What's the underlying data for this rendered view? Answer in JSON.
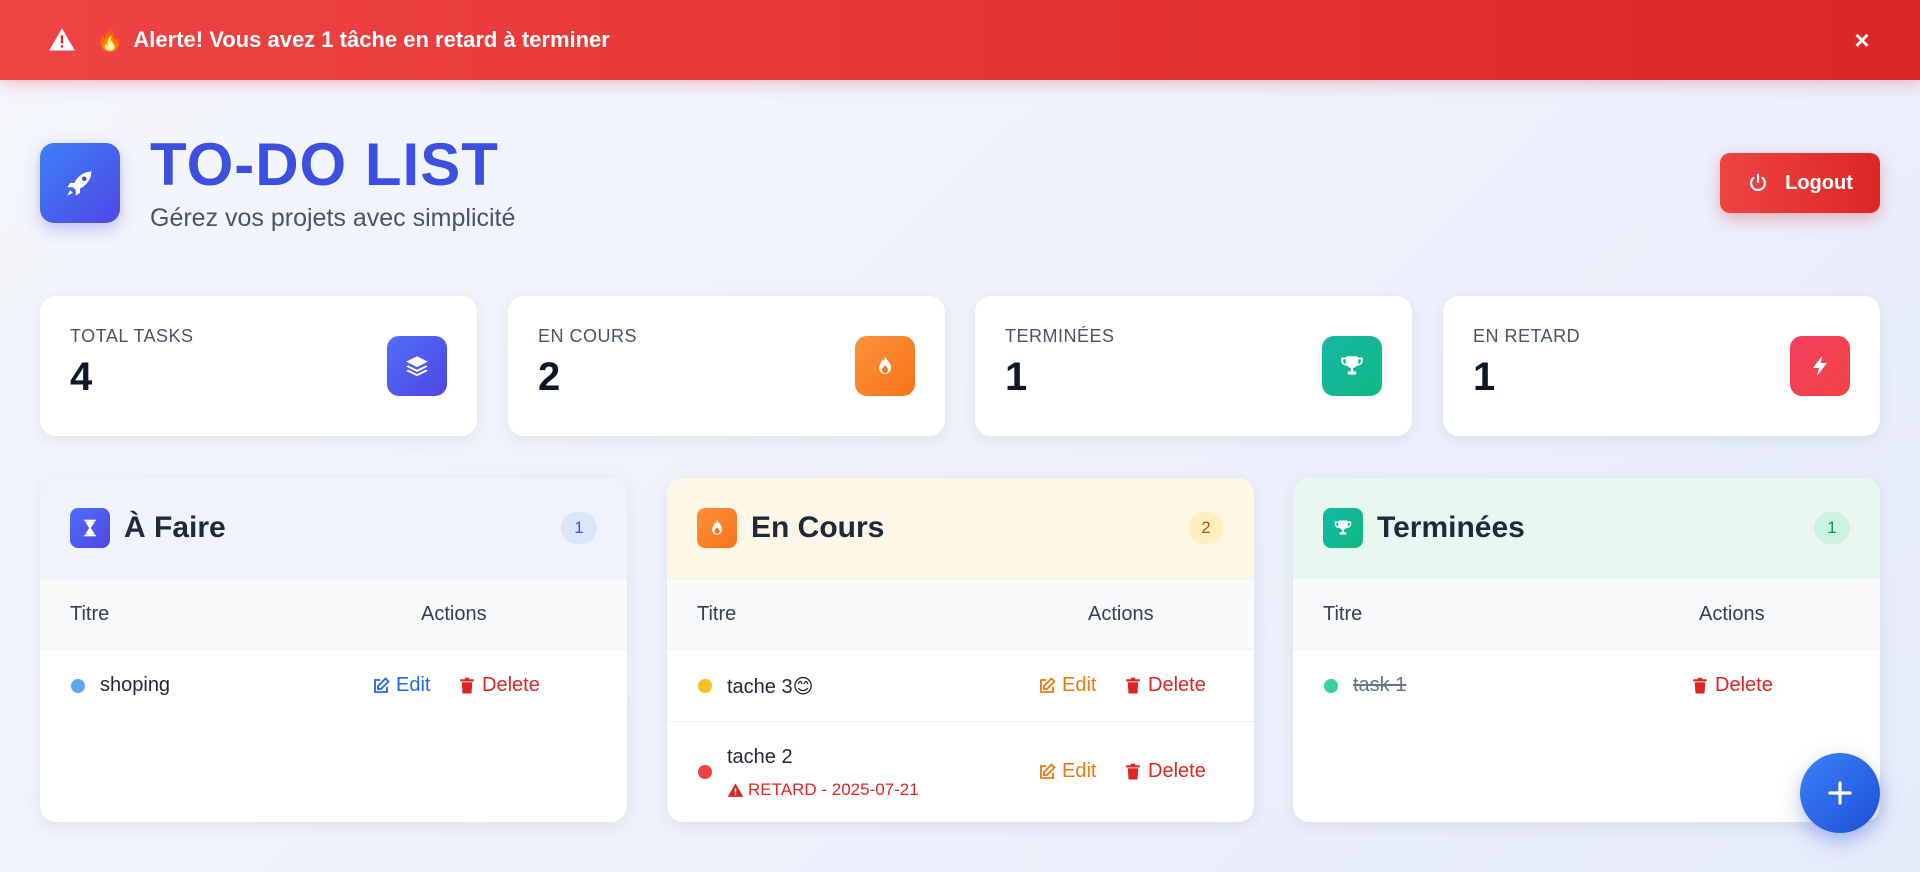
{
  "alert": {
    "emoji": "🔥",
    "message": "Alerte! Vous avez 1 tâche en retard à terminer",
    "close": "×"
  },
  "header": {
    "title": "TO-DO LIST",
    "subtitle": "Gérez vos projets avec simplicité",
    "logout_label": "Logout"
  },
  "stats": [
    {
      "label": "TOTAL TASKS",
      "value": "4",
      "icon": "layers-icon",
      "color": "#4f46e5"
    },
    {
      "label": "EN COURS",
      "value": "2",
      "icon": "fire-icon",
      "color": "#f97316"
    },
    {
      "label": "TERMINÉES",
      "value": "1",
      "icon": "trophy-icon",
      "color": "#10b981"
    },
    {
      "label": "EN RETARD",
      "value": "1",
      "icon": "bolt-icon",
      "color": "#ef4444"
    }
  ],
  "columns": {
    "todo": {
      "title": "À Faire",
      "count": "1",
      "col_title": "Titre",
      "col_actions": "Actions",
      "tasks": [
        {
          "title": "shoping",
          "edit": "Edit",
          "delete": "Delete"
        }
      ]
    },
    "inprogress": {
      "title": "En Cours",
      "count": "2",
      "col_title": "Titre",
      "col_actions": "Actions",
      "tasks": [
        {
          "title": "tache 3😊",
          "edit": "Edit",
          "delete": "Delete"
        },
        {
          "title": "tache 2",
          "late": "RETARD - 2025-07-21",
          "edit": "Edit",
          "delete": "Delete"
        }
      ]
    },
    "done": {
      "title": "Terminées",
      "count": "1",
      "col_title": "Titre",
      "col_actions": "Actions",
      "tasks": [
        {
          "title": "task 1",
          "delete": "Delete"
        }
      ]
    }
  },
  "colors": {
    "primary": "#3b4fe0",
    "danger": "#dc2626",
    "warning": "#f59e0b",
    "success": "#10b981",
    "edit_blue": "#2563eb",
    "edit_orange": "#ea7a0c"
  }
}
